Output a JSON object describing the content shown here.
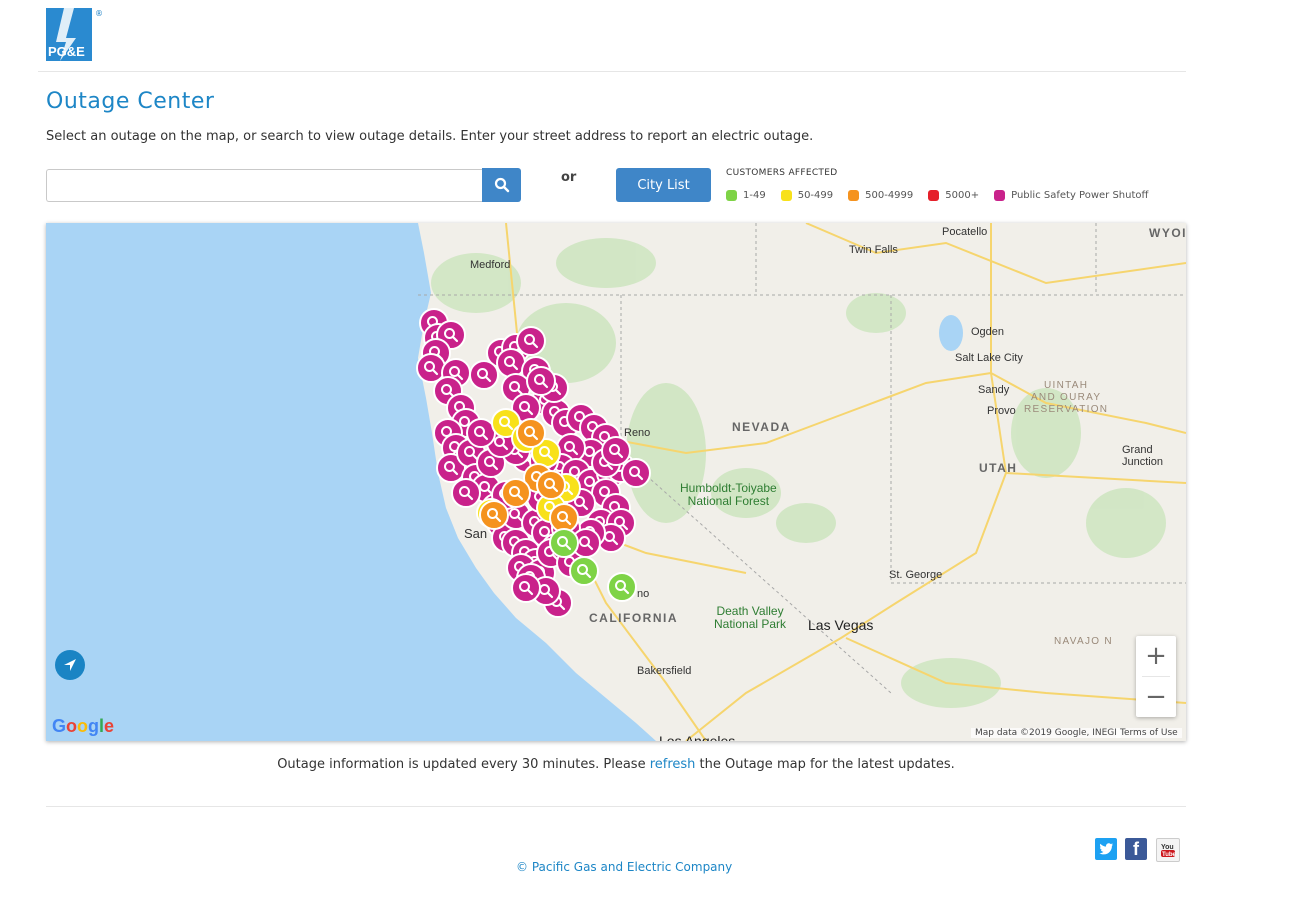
{
  "header": {
    "logo_text": "PG&E",
    "registered_mark": "®"
  },
  "page": {
    "title": "Outage Center",
    "intro": "Select an outage on the map, or search to view outage details. Enter your street address to report an electric outage."
  },
  "search": {
    "placeholder": "",
    "value": "",
    "button_icon": "search-icon",
    "or_label": "or",
    "city_list_label": "City List"
  },
  "legend": {
    "title": "CUSTOMERS AFFECTED",
    "items": [
      {
        "label": "1-49",
        "color": "#7ed346"
      },
      {
        "label": "50-499",
        "color": "#f8e11a"
      },
      {
        "label": "500-4999",
        "color": "#f5931f"
      },
      {
        "label": "5000+",
        "color": "#e5202a"
      },
      {
        "label": "Public Safety Power Shutoff",
        "color": "#c9228b"
      }
    ]
  },
  "map": {
    "labels": {
      "medford": "Medford",
      "twin_falls": "Twin Falls",
      "pocatello": "Pocatello",
      "wyoming": "WYOI",
      "ogden": "Ogden",
      "slc": "Salt Lake City",
      "sandy": "Sandy",
      "provo": "Provo",
      "uintah": "UINTAH\nAND OURAY\nRESERVATION",
      "nevada": "NEVADA",
      "reno": "Reno",
      "utah": "UTAH",
      "grand_junction": "Grand\nJunction",
      "humboldt": "Humboldt-Toiyabe\nNational Forest",
      "san": "San",
      "st_george": "St. George",
      "fresno": "no",
      "california": "CALIFORNIA",
      "death_valley": "Death Valley\nNational Park",
      "las_vegas": "Las Vegas",
      "navajo": "NAVAJO N",
      "bakersfield": "Bakersfield",
      "los_angeles": "Los Angeles"
    },
    "attribution": "Map data ©2019 Google, INEGI",
    "terms": "Terms of Use",
    "google": "Google",
    "zoom_in": "+",
    "zoom_out": "−"
  },
  "footer": {
    "note_before": "Outage information is updated every 30 minutes. Please ",
    "note_link": "refresh",
    "note_after": " the Outage map for the latest updates.",
    "copyright": "© Pacific Gas and Electric Company",
    "social": [
      "twitter-icon",
      "facebook-icon",
      "youtube-icon"
    ]
  }
}
